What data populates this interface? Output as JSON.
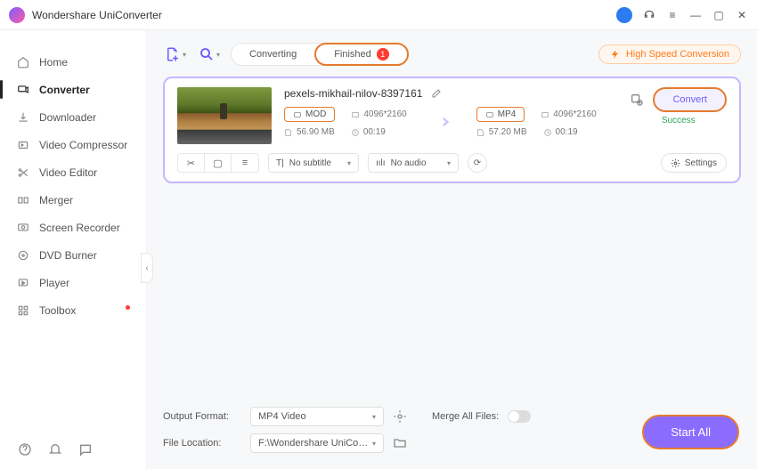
{
  "app": {
    "title": "Wondershare UniConverter"
  },
  "sidebar": {
    "items": [
      {
        "label": "Home"
      },
      {
        "label": "Converter"
      },
      {
        "label": "Downloader"
      },
      {
        "label": "Video Compressor"
      },
      {
        "label": "Video Editor"
      },
      {
        "label": "Merger"
      },
      {
        "label": "Screen Recorder"
      },
      {
        "label": "DVD Burner"
      },
      {
        "label": "Player"
      },
      {
        "label": "Toolbox"
      }
    ]
  },
  "tabs": {
    "converting": "Converting",
    "finished": "Finished",
    "finished_count": "1"
  },
  "hsc": "High Speed Conversion",
  "task": {
    "filename": "pexels-mikhail-nilov-8397161",
    "src": {
      "fmt": "MOD",
      "res": "4096*2160",
      "size": "56.90 MB",
      "dur": "00:19"
    },
    "dst": {
      "fmt": "MP4",
      "res": "4096*2160",
      "size": "57.20 MB",
      "dur": "00:19"
    },
    "convert_label": "Convert",
    "status": "Success",
    "subtitle": "No subtitle",
    "audio": "No audio",
    "settings_label": "Settings"
  },
  "footer": {
    "output_label": "Output Format:",
    "output_value": "MP4 Video",
    "location_label": "File Location:",
    "location_value": "F:\\Wondershare UniConverter",
    "merge_label": "Merge All Files:",
    "start_all": "Start All"
  }
}
